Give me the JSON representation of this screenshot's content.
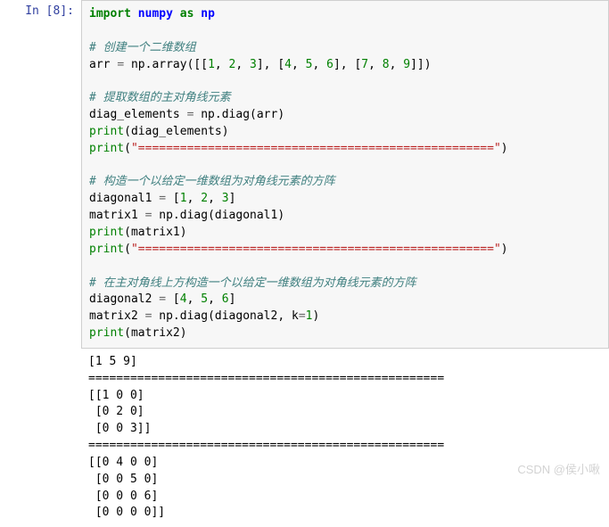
{
  "prompt": {
    "in_label": "In [8]:"
  },
  "code": {
    "import_kw": "import",
    "numpy": "numpy",
    "as_kw": "as",
    "np": "np",
    "cmt1": "# 创建一个二维数组",
    "arr_line_pre": "arr ",
    "eq": "=",
    "arr_line_post": " np.array([[",
    "n1": "1",
    "n2": "2",
    "n3": "3",
    "n4": "4",
    "n5": "5",
    "n6": "6",
    "n7": "7",
    "n8": "8",
    "n9": "9",
    "arr_mid1": ", ",
    "arr_mid2": ", ",
    "arr_close1": "], [",
    "arr_close2": "], [",
    "arr_end": "]])",
    "cmt2": "# 提取数组的主对角线元素",
    "diag_el": "diag_elements ",
    "diag_el_post": " np.diag(arr)",
    "print_bi": "print",
    "p1_arg": "(diag_elements)",
    "p_sep_str": "\"===================================================\"",
    "cmt3": "# 构造一个以给定一维数组为对角线元素的方阵",
    "diag1_name": "diagonal1 ",
    "diag1_post": " [",
    "diag1_end": "]",
    "m1_name": "matrix1 ",
    "m1_post": " np.diag(diagonal1)",
    "p_m1_arg": "(matrix1)",
    "cmt4": "# 在主对角线上方构造一个以给定一维数组为对角线元素的方阵",
    "diag2_name": "diagonal2 ",
    "diag2_post": " [",
    "diag2_end": "]",
    "m2_name": "matrix2 ",
    "m2_post": " np.diag(diagonal2, k",
    "m2_k": "1",
    "m2_end": ")",
    "p_m2_arg": "(matrix2)"
  },
  "output": {
    "line1": "[1 5 9]",
    "sep": "===================================================",
    "block2": "[[1 0 0]\n [0 2 0]\n [0 0 3]]",
    "block3": "[[0 4 0 0]\n [0 0 5 0]\n [0 0 0 6]\n [0 0 0 0]]"
  },
  "watermark": "CSDN @侯小啾"
}
